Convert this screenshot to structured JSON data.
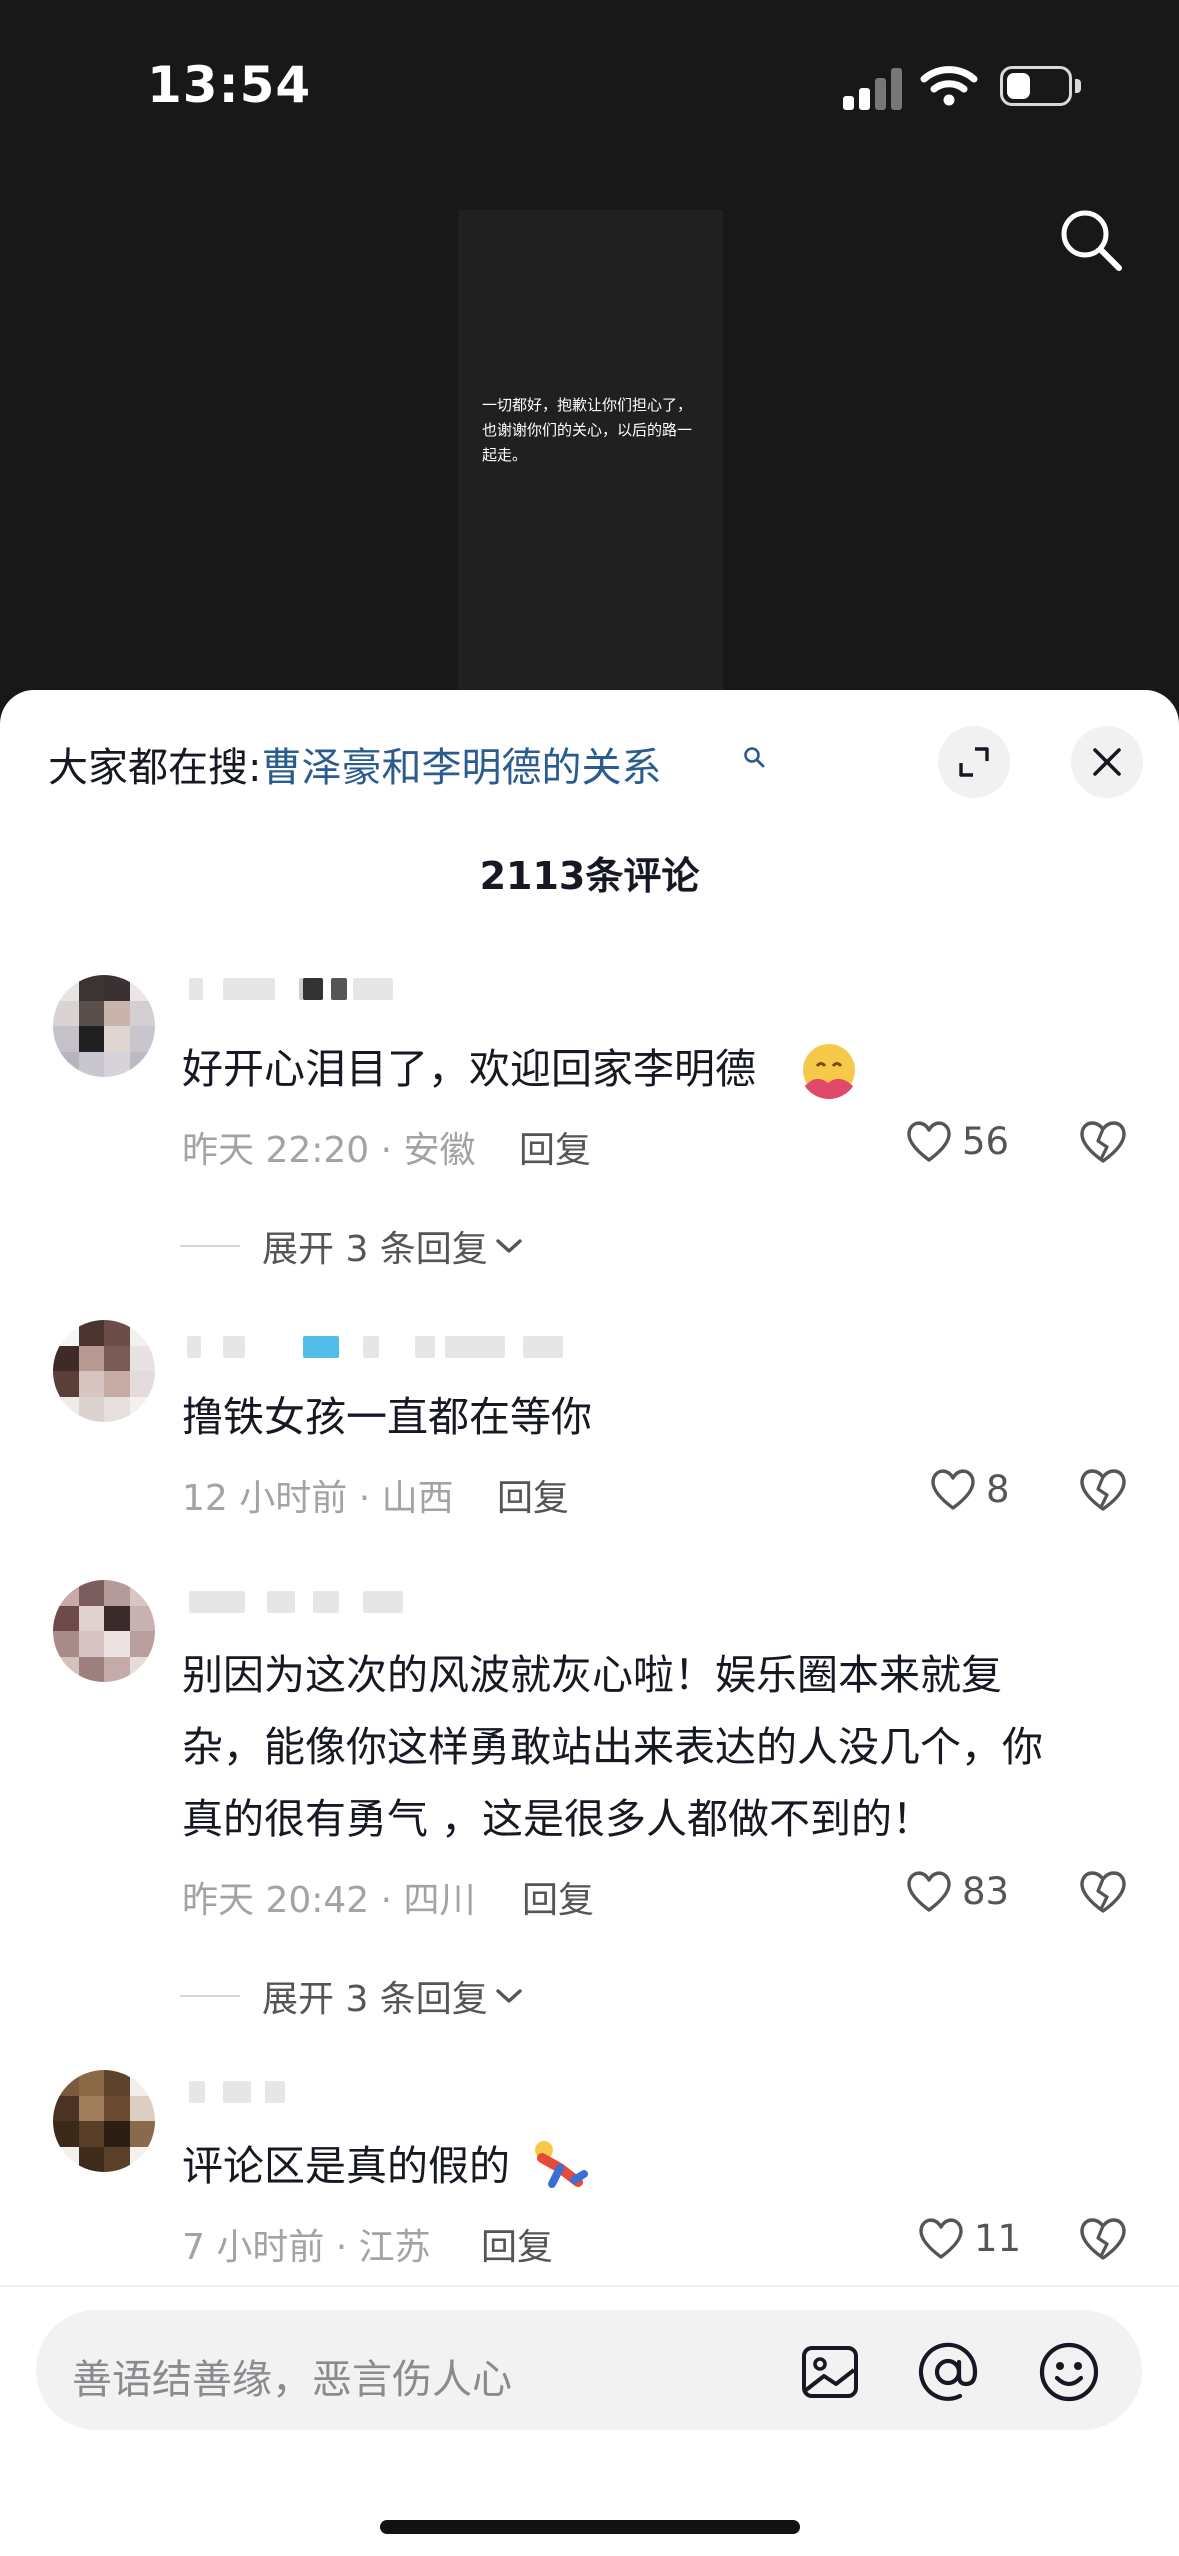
{
  "status_bar": {
    "time": "13:54",
    "battery_level": 0.4
  },
  "video": {
    "caption": "一切都好，抱歉让你们担心了，也谢谢你们的关心，以后的路一起走。"
  },
  "sheet": {
    "hot_search_prefix": "大家都在搜:",
    "hot_search_query": "曹泽豪和李明德的关系",
    "comments_count": "2113条评论"
  },
  "comments": [
    {
      "text": "好开心泪目了，欢迎回家李明德",
      "meta": "昨天 22:20 · 安徽",
      "reply": "回复",
      "likes": "56",
      "expand": "展开 3 条回复"
    },
    {
      "text": "撸铁女孩一直都在等你",
      "meta": "12 小时前 · 山西",
      "reply": "回复",
      "likes": "8"
    },
    {
      "text_lines": [
        "别因为这次的风波就灰心啦！娱乐圈本来就复",
        "杂，能像你这样勇敢站出来表达的人没几个，你",
        "真的很有勇气 ，这是很多人都做不到的！"
      ],
      "meta": "昨天 20:42 · 四川",
      "reply": "回复",
      "likes": "83",
      "expand": "展开 3 条回复"
    },
    {
      "text": "评论区是真的假的",
      "meta": "7 小时前 · 江苏",
      "reply": "回复",
      "likes": "11"
    }
  ],
  "input": {
    "placeholder": "善语结善缘，恶言伤人心"
  },
  "icons": {
    "search": "search-icon",
    "expand": "expand-icon",
    "close": "close-icon",
    "like": "heart-icon",
    "dislike": "broken-heart-icon",
    "image": "image-icon",
    "mention": "at-icon",
    "emoji": "smiley-icon"
  },
  "colors": {
    "link": "#2b5c8f",
    "meta": "#a3a3a3",
    "sheet": "#ffffff"
  }
}
